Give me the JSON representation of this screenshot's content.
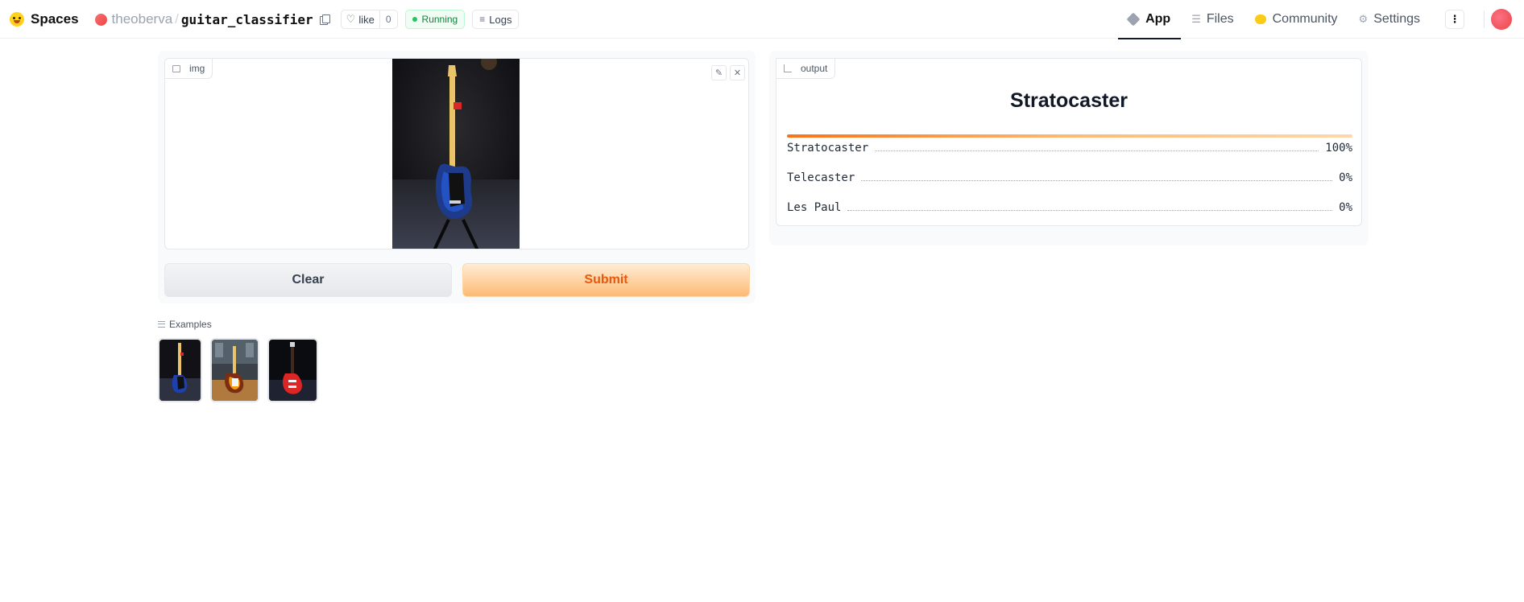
{
  "header": {
    "brand": "Spaces",
    "owner": "theoberva",
    "separator": "/",
    "repo": "guitar_classifier",
    "like_label": "like",
    "like_count": "0",
    "status": "Running",
    "logs_label": "Logs",
    "tabs": [
      {
        "label": "App",
        "icon": "cube-icon",
        "active": true
      },
      {
        "label": "Files",
        "icon": "files-icon",
        "active": false
      },
      {
        "label": "Community",
        "icon": "community-icon",
        "active": false
      },
      {
        "label": "Settings",
        "icon": "gear-icon",
        "active": false
      }
    ],
    "more_label": "⋮"
  },
  "input": {
    "chip_label": "img",
    "clear_label": "Clear",
    "submit_label": "Submit",
    "tools": [
      "edit-icon",
      "close-icon"
    ]
  },
  "output": {
    "chip_label": "output",
    "predicted_label": "Stratocaster",
    "confidences": [
      {
        "label": "Stratocaster",
        "value": "100%",
        "fraction": 1.0
      },
      {
        "label": "Telecaster",
        "value": "0%",
        "fraction": 0.0
      },
      {
        "label": "Les Paul",
        "value": "0%",
        "fraction": 0.0
      }
    ]
  },
  "examples": {
    "label": "Examples",
    "items": [
      "blue stratocaster",
      "sunburst telecaster",
      "red les paul"
    ]
  },
  "colors": {
    "accent": "#f97316",
    "running": "#22c55e",
    "submit_text": "#ea580c"
  }
}
